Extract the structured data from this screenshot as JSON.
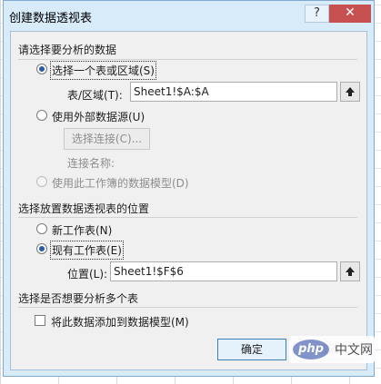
{
  "dialog": {
    "title": "创建数据透视表",
    "help_label": "?",
    "close_label": "✕"
  },
  "section_data": {
    "header": "请选择要分析的数据",
    "option_select_range": "选择一个表或区域(S)",
    "table_range_label": "表/区域(T):",
    "table_range_value": "Sheet1!$A:$A",
    "option_external_source": "使用外部数据源(U)",
    "choose_connection_label": "选择连接(C)...",
    "connection_name_label": "连接名称:",
    "option_data_model": "使用此工作簿的数据模型(D)"
  },
  "section_location": {
    "header": "选择放置数据透视表的位置",
    "option_new_sheet": "新工作表(N)",
    "option_existing_sheet": "现有工作表(E)",
    "location_label": "位置(L):",
    "location_value": "Sheet1!$F$6"
  },
  "section_multi": {
    "header": "选择是否想要分析多个表",
    "add_to_model_label": "将此数据添加到数据模型(M)"
  },
  "buttons": {
    "ok": "确定",
    "cancel": "取消"
  },
  "watermark": {
    "logo": "php",
    "text": "中文网"
  }
}
